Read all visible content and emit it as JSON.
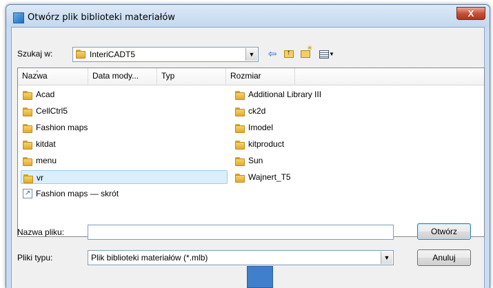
{
  "window": {
    "title": "Otwórz plik biblioteki materiałów",
    "close_label": "X"
  },
  "lookin": {
    "label": "Szukaj w:",
    "value": "InteriCADT5"
  },
  "toolbar": {
    "icons": [
      "back-arrow-icon",
      "up-folder-icon",
      "new-folder-icon",
      "view-menu-icon"
    ]
  },
  "columns": [
    "Nazwa",
    "Data mody...",
    "Typ",
    "Rozmiar"
  ],
  "files": {
    "col1": [
      "Acad",
      "CellCtrl5",
      "Fashion maps",
      "kitdat",
      "menu",
      "vr",
      "Fashion maps — skrót"
    ],
    "col2": [
      "Additional Library III",
      "ck2d",
      "Imodel",
      "kitproduct",
      "Sun",
      "Wajnert_T5"
    ],
    "selected": "vr"
  },
  "filename": {
    "label": "Nazwa pliku:",
    "value": ""
  },
  "filetype": {
    "label": "Pliki typu:",
    "value": "Plik biblioteki materiałów (*.mlb)"
  },
  "buttons": {
    "open": "Otwórz",
    "cancel": "Anuluj"
  },
  "colors": {
    "selection": "#dbeefd",
    "close": "#c7503a",
    "folder": "#f0c24e"
  }
}
